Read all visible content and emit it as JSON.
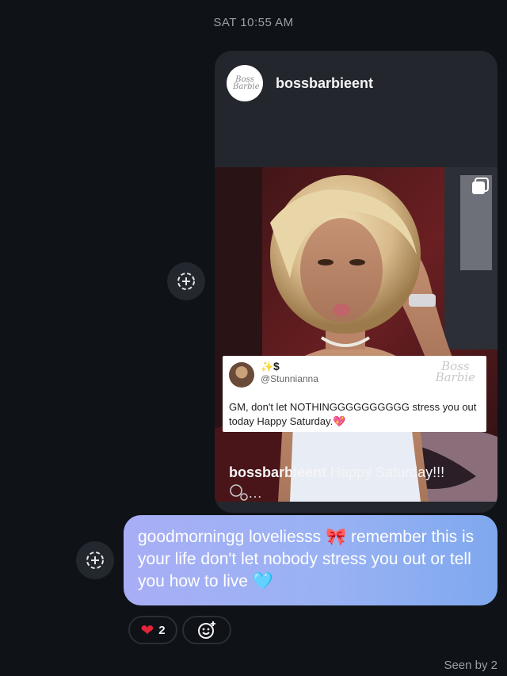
{
  "thread": {
    "timestamp": "SAT 10:55 AM"
  },
  "shared_post": {
    "avatar_text": "Boss Barbie",
    "username": "bossbarbieent",
    "carousel_icon": "multiple-images-icon",
    "quote": {
      "sparkle": "✨",
      "dollar": "$",
      "handle": "@Stunnianna",
      "logo_text": "Boss Barbie",
      "text": "GM, don't let NOTHINGGGGGGGGGG stress you out today Happy Saturday.",
      "emoji": "💖"
    },
    "caption_user": "bossbarbieent",
    "caption_text": " Happy Saturday!!!",
    "caption_more": "…"
  },
  "message": {
    "text_part1": "goodmorningg loveliesss ",
    "emoji1": "🎀",
    "text_part2": " remember this is your life don't let nobody stress you out or tell you how to live ",
    "emoji2": "🩵"
  },
  "reactions": {
    "heart_emoji": "❤",
    "heart_count": "2",
    "add_reaction_icon": "add-reaction-icon"
  },
  "status": {
    "seen": "Seen by 2"
  },
  "colors": {
    "background": "#0f1217",
    "card": "#23262c",
    "bubble_start": "#a8aef5",
    "bubble_end": "#7fa8ee",
    "heart": "#e0243a"
  }
}
